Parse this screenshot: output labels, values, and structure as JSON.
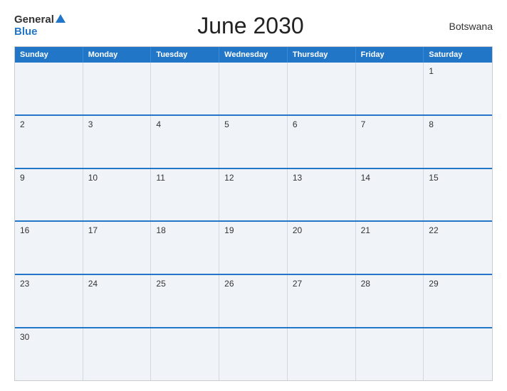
{
  "header": {
    "logo_general": "General",
    "logo_blue": "Blue",
    "title": "June 2030",
    "country": "Botswana"
  },
  "calendar": {
    "days_of_week": [
      "Sunday",
      "Monday",
      "Tuesday",
      "Wednesday",
      "Thursday",
      "Friday",
      "Saturday"
    ],
    "weeks": [
      [
        {
          "day": "",
          "empty": true
        },
        {
          "day": "",
          "empty": true
        },
        {
          "day": "",
          "empty": true
        },
        {
          "day": "",
          "empty": true
        },
        {
          "day": "",
          "empty": true
        },
        {
          "day": "",
          "empty": true
        },
        {
          "day": "1",
          "empty": false
        }
      ],
      [
        {
          "day": "2",
          "empty": false
        },
        {
          "day": "3",
          "empty": false
        },
        {
          "day": "4",
          "empty": false
        },
        {
          "day": "5",
          "empty": false
        },
        {
          "day": "6",
          "empty": false
        },
        {
          "day": "7",
          "empty": false
        },
        {
          "day": "8",
          "empty": false
        }
      ],
      [
        {
          "day": "9",
          "empty": false
        },
        {
          "day": "10",
          "empty": false
        },
        {
          "day": "11",
          "empty": false
        },
        {
          "day": "12",
          "empty": false
        },
        {
          "day": "13",
          "empty": false
        },
        {
          "day": "14",
          "empty": false
        },
        {
          "day": "15",
          "empty": false
        }
      ],
      [
        {
          "day": "16",
          "empty": false
        },
        {
          "day": "17",
          "empty": false
        },
        {
          "day": "18",
          "empty": false
        },
        {
          "day": "19",
          "empty": false
        },
        {
          "day": "20",
          "empty": false
        },
        {
          "day": "21",
          "empty": false
        },
        {
          "day": "22",
          "empty": false
        }
      ],
      [
        {
          "day": "23",
          "empty": false
        },
        {
          "day": "24",
          "empty": false
        },
        {
          "day": "25",
          "empty": false
        },
        {
          "day": "26",
          "empty": false
        },
        {
          "day": "27",
          "empty": false
        },
        {
          "day": "28",
          "empty": false
        },
        {
          "day": "29",
          "empty": false
        }
      ],
      [
        {
          "day": "30",
          "empty": false
        },
        {
          "day": "",
          "empty": true
        },
        {
          "day": "",
          "empty": true
        },
        {
          "day": "",
          "empty": true
        },
        {
          "day": "",
          "empty": true
        },
        {
          "day": "",
          "empty": true
        },
        {
          "day": "",
          "empty": true
        }
      ]
    ]
  }
}
